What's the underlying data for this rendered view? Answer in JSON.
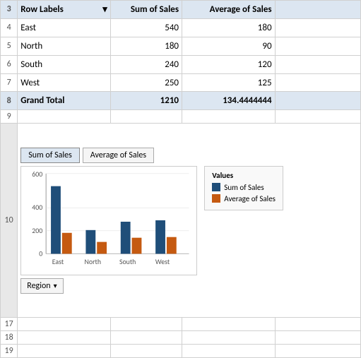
{
  "rows": {
    "header": {
      "rowNum": "3",
      "labelCol": "Row Labels",
      "sumCol": "Sum of Sales",
      "avgCol": "Average of Sales"
    },
    "data": [
      {
        "rowNum": "4",
        "label": "East",
        "sum": "540",
        "avg": "180"
      },
      {
        "rowNum": "5",
        "label": "North",
        "sum": "180",
        "avg": "90"
      },
      {
        "rowNum": "6",
        "label": "South",
        "sum": "240",
        "avg": "120"
      },
      {
        "rowNum": "7",
        "label": "West",
        "sum": "250",
        "avg": "125"
      }
    ],
    "grandTotal": {
      "rowNum": "8",
      "label": "Grand Total",
      "sum": "1210",
      "avg": "134.4444444"
    },
    "emptyRows": [
      "9",
      "10",
      "17",
      "18",
      "19"
    ]
  },
  "chart": {
    "buttons": [
      "Sum of Sales",
      "Average of Sales"
    ],
    "activeButton": "Sum of Sales",
    "legend": {
      "title": "Values",
      "items": [
        {
          "label": "Sum of Sales",
          "color": "#1f4e79"
        },
        {
          "label": "Average of Sales",
          "color": "#c55a11"
        }
      ]
    },
    "yAxis": {
      "max": 600,
      "ticks": [
        0,
        200,
        400,
        600
      ]
    },
    "categories": [
      "East",
      "North",
      "South",
      "West"
    ],
    "series": {
      "sum": [
        540,
        180,
        240,
        250
      ],
      "average": [
        180,
        90,
        120,
        125
      ]
    },
    "regionButton": "Region"
  }
}
